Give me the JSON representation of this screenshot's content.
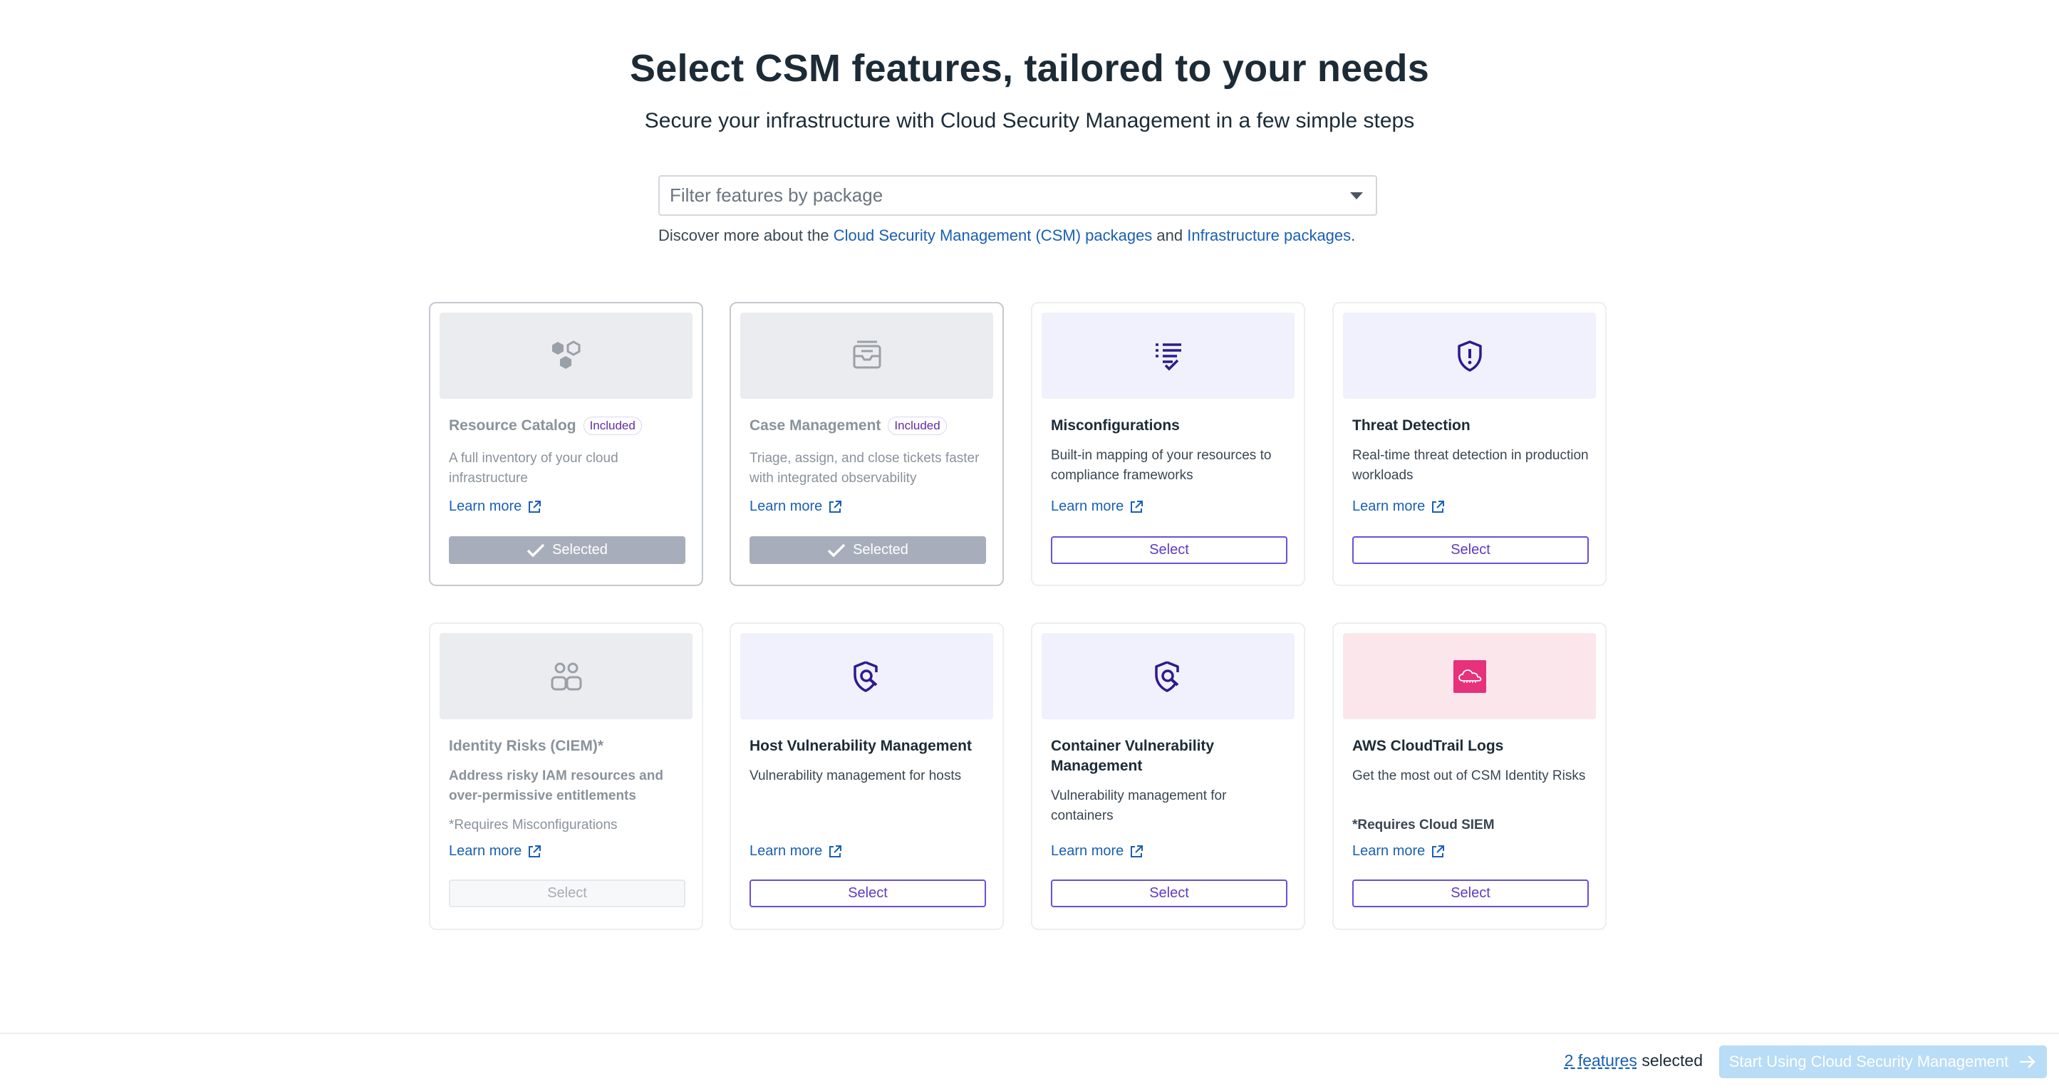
{
  "header": {
    "title": "Select CSM features, tailored to your needs",
    "subtitle": "Secure your infrastructure with Cloud Security Management in a few simple steps"
  },
  "filter": {
    "placeholder": "Filter features by package",
    "discover_prefix": "Discover more about the ",
    "csm_link": "Cloud Security Management (CSM) packages",
    "and_text": " and ",
    "infra_link": "Infrastructure packages",
    "period": "."
  },
  "cards": [
    {
      "title": "Resource Catalog",
      "badge": "Included",
      "description": "A full inventory of your cloud infrastructure",
      "learn_more": "Learn more",
      "button": "Selected",
      "state": "selected",
      "icon": "hexagons-icon"
    },
    {
      "title": "Case Management",
      "badge": "Included",
      "description": "Triage, assign, and close tickets faster with integrated observability",
      "learn_more": "Learn more",
      "button": "Selected",
      "state": "selected",
      "icon": "inbox-icon"
    },
    {
      "title": "Misconfigurations",
      "description": "Built-in mapping of your resources to compliance frameworks",
      "learn_more": "Learn more",
      "button": "Select",
      "state": "available",
      "icon": "checklist-icon"
    },
    {
      "title": "Threat Detection",
      "description": "Real-time threat detection in production workloads",
      "learn_more": "Learn more",
      "button": "Select",
      "state": "available",
      "icon": "shield-alert-icon"
    },
    {
      "title": "Identity Risks (CIEM)*",
      "description": "Address risky IAM resources and over-permissive entitlements",
      "note": "*Requires Misconfigurations",
      "learn_more": "Learn more",
      "button": "Select",
      "state": "disabled",
      "icon": "users-icon"
    },
    {
      "title": "Host Vulnerability Management",
      "description": "Vulnerability management for hosts",
      "learn_more": "Learn more",
      "button": "Select",
      "state": "available",
      "icon": "shield-search-icon"
    },
    {
      "title": "Container Vulnerability Management",
      "description": "Vulnerability management for containers",
      "learn_more": "Learn more",
      "button": "Select",
      "state": "available",
      "icon": "shield-search-icon"
    },
    {
      "title": "AWS CloudTrail Logs",
      "description": "Get the most out of CSM Identity Risks",
      "note": "*Requires Cloud SIEM",
      "learn_more": "Learn more",
      "button": "Select",
      "state": "available",
      "icon": "aws-cloudtrail-icon"
    }
  ],
  "footer": {
    "count_link": "2 features",
    "count_suffix": " selected",
    "cta": "Start Using Cloud Security Management"
  },
  "colors": {
    "accent": "#632ca6",
    "link": "#1a5fb4",
    "selected_button": "#a8adbb",
    "cta_disabled": "#b9dcf7",
    "cloudtrail_brand": "#e7317a"
  }
}
